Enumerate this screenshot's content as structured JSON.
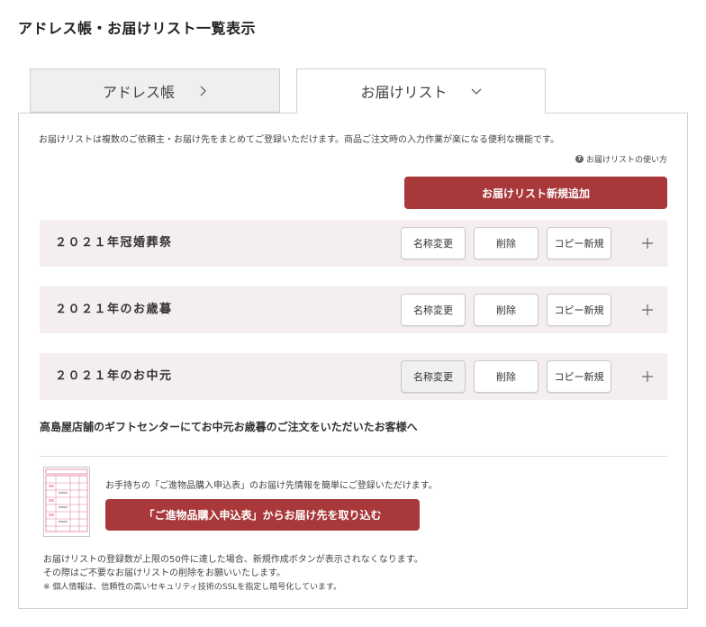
{
  "page": {
    "title": "アドレス帳・お届けリスト一覧表示"
  },
  "tabs": [
    {
      "label": "アドレス帳",
      "arrow": "›"
    },
    {
      "label": "お届けリスト",
      "arrow": "⌄"
    }
  ],
  "intro": "お届けリストは複数のご依頼主・お届け先をまとめてご登録いただけます。商品ご注文時の入力作業が楽になる便利な機能です。",
  "help": {
    "label": "お届けリストの使い方",
    "icon": "help-circle-icon"
  },
  "add_button": "お届けリスト新規追加",
  "row_buttons": {
    "rename": "名称変更",
    "delete": "削除",
    "copy": "コピー新規"
  },
  "lists": [
    {
      "title": "２０２１年冠婚葬祭"
    },
    {
      "title": "２０２１年のお歳暮"
    },
    {
      "title": "２０２１年のお中元"
    }
  ],
  "gift_center": {
    "heading": "高島屋店舗のギフトセンターにてお中元お歳暮のご注文をいただいたお客様へ",
    "note": "お手持ちの「ご進物品購入申込表」のお届け先情報を簡単にご登録いただけます。",
    "import_button": "「ご進物品購入申込表」からお届け先を取り込む"
  },
  "notes": {
    "limit_1": "お届けリストの登録数が上限の50件に達した場合、新規作成ボタンが表示されなくなります。",
    "limit_2": "その際はご不要なお届けリストの削除をお願いいたします。",
    "ssl": "※ 個人情報は、信頼性の高いセキュリティ技術のSSLを指定し暗号化しています。"
  },
  "colors": {
    "accent": "#a8383a",
    "row_bg": "#f5eeee",
    "tab_inactive_bg": "#efefef"
  }
}
